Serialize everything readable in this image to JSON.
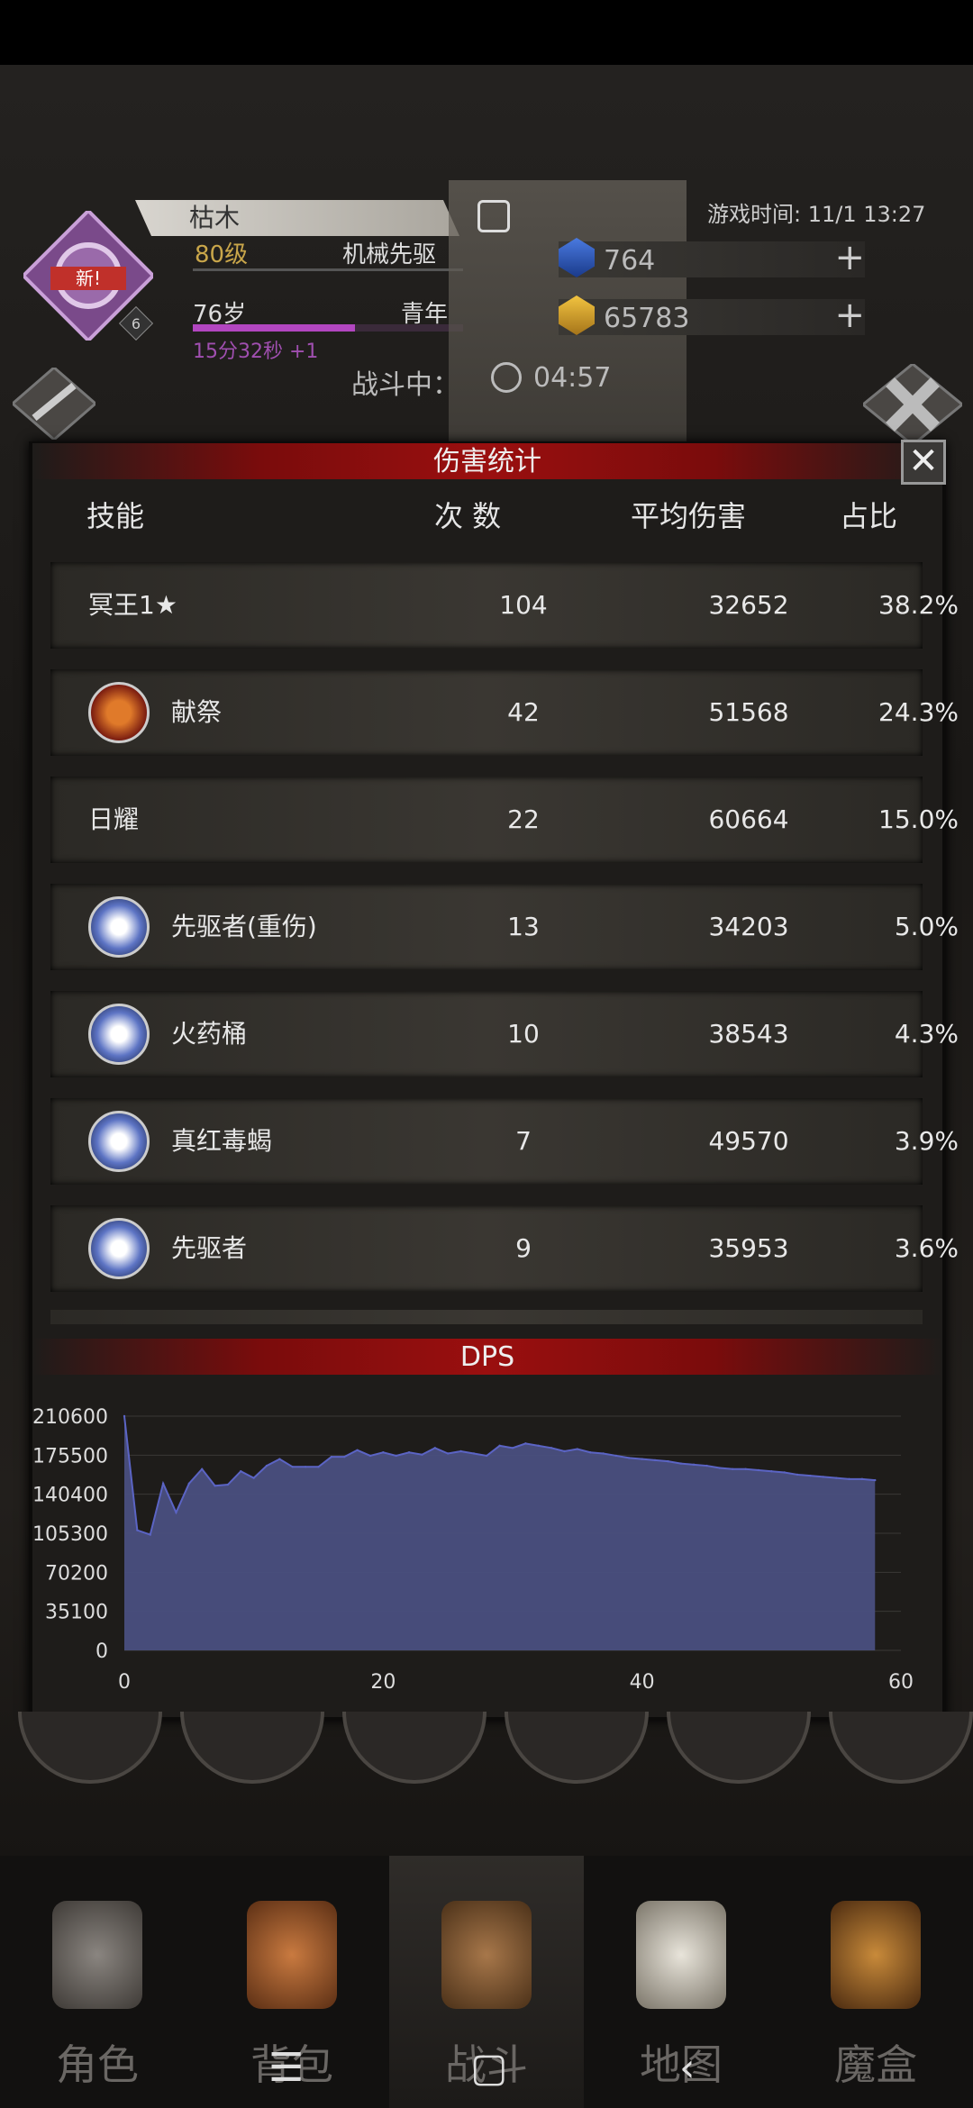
{
  "header": {
    "char_name": "枯木",
    "level": "80级",
    "class": "机械先驱",
    "age": "76岁",
    "age_stage": "青年",
    "age_timer": "15分32秒 +1",
    "badge_new": "新!",
    "badge_num": "6",
    "game_time": "游戏时间: 11/1 13:27",
    "gems": "764",
    "gold": "65783",
    "battle_label": "战斗中：",
    "battle_timer": "04:57"
  },
  "damage_stats": {
    "title": "伤害统计",
    "close_icon": "✕",
    "columns": [
      "技能",
      "次 数",
      "平均伤害",
      "占比"
    ],
    "rows": [
      {
        "name": "冥王1★",
        "count": "104",
        "avg": "32652",
        "pct": "38.2%",
        "icon": ""
      },
      {
        "name": "献祭",
        "count": "42",
        "avg": "51568",
        "pct": "24.3%",
        "icon": "sacrifice-icon"
      },
      {
        "name": "日耀",
        "count": "22",
        "avg": "60664",
        "pct": "15.0%",
        "icon": ""
      },
      {
        "name": "先驱者(重伤)",
        "count": "13",
        "avg": "34203",
        "pct": "5.0%",
        "icon": "vanguard-icon"
      },
      {
        "name": "火药桶",
        "count": "10",
        "avg": "38543",
        "pct": "4.3%",
        "icon": "powder-keg-icon"
      },
      {
        "name": "真红毒蝎",
        "count": "7",
        "avg": "49570",
        "pct": "3.9%",
        "icon": "scorpion-icon"
      },
      {
        "name": "先驱者",
        "count": "9",
        "avg": "35953",
        "pct": "3.6%",
        "icon": "vanguard-icon"
      }
    ]
  },
  "chart_data": {
    "type": "area",
    "title": "DPS",
    "xlabel": "",
    "ylabel": "",
    "xlim": [
      0,
      60
    ],
    "ylim": [
      0,
      210600
    ],
    "x_ticks": [
      "0",
      "20",
      "40",
      "60"
    ],
    "y_ticks": [
      "210600",
      "175500",
      "140400",
      "105300",
      "70200",
      "35100",
      "0"
    ],
    "grid": true,
    "fill_color": "#4a4f80",
    "line_color": "#5b64c4",
    "x": [
      0,
      1,
      2,
      3,
      4,
      5,
      6,
      7,
      8,
      9,
      10,
      11,
      12,
      13,
      14,
      15,
      16,
      17,
      18,
      19,
      20,
      21,
      22,
      23,
      24,
      25,
      26,
      27,
      28,
      29,
      30,
      31,
      32,
      33,
      34,
      35,
      36,
      37,
      38,
      39,
      40,
      41,
      42,
      43,
      44,
      45,
      46,
      47,
      48,
      49,
      50,
      51,
      52,
      53,
      54,
      55,
      56,
      57,
      58
    ],
    "y": [
      210600,
      108000,
      104000,
      150000,
      124000,
      150000,
      163000,
      148000,
      149000,
      161000,
      155000,
      166000,
      172000,
      165000,
      165000,
      165000,
      174000,
      174000,
      180000,
      175000,
      178000,
      175000,
      178000,
      176000,
      182000,
      177000,
      179000,
      177000,
      175000,
      184000,
      182000,
      186000,
      184000,
      182000,
      179000,
      181000,
      178000,
      177000,
      175000,
      173000,
      172000,
      171000,
      170000,
      168000,
      167000,
      166000,
      164000,
      163000,
      163000,
      162000,
      161000,
      160000,
      158000,
      157000,
      156000,
      155000,
      154000,
      154000,
      153000
    ]
  },
  "skill_bar_count": 6,
  "bottom_nav": [
    "角色",
    "背包",
    "战斗",
    "地图",
    "魔盒"
  ],
  "sys_nav": [
    "☰",
    "▢",
    "‹"
  ]
}
